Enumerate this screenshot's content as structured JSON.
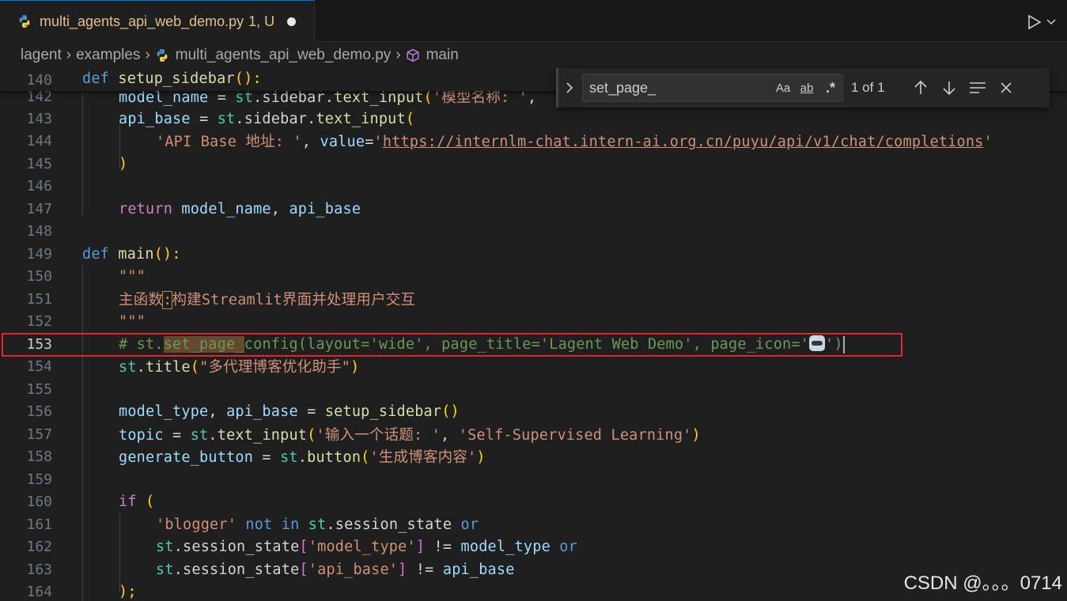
{
  "tab": {
    "filename": "multi_agents_api_web_demo.py",
    "status": "1, U"
  },
  "breadcrumb": {
    "items": [
      "lagent",
      "examples",
      "multi_agents_api_web_demo.py",
      "main"
    ]
  },
  "find": {
    "query": "set_page_",
    "case_label": "Aa",
    "word_label": "ab",
    "regex_label": ".*",
    "count": "1 of 1"
  },
  "lines": {
    "140": "140",
    "142": "142",
    "143": "143",
    "144": "144",
    "145": "145",
    "146": "146",
    "147": "147",
    "148": "148",
    "149": "149",
    "150": "150",
    "151": "151",
    "152": "152",
    "153": "153",
    "154": "154",
    "155": "155",
    "156": "156",
    "157": "157",
    "158": "158",
    "159": "159",
    "160": "160",
    "161": "161",
    "162": "162",
    "163": "163",
    "164": "164"
  },
  "code": {
    "t140": {
      "def": "def",
      "name": "setup_sidebar",
      "rest": "():"
    },
    "t142": {
      "a": "model_name",
      "b": " = ",
      "c": "st",
      "d": ".sidebar.",
      "e": "text_input",
      "f": "(",
      "g": "'模型名称: '",
      "h": ","
    },
    "t143": {
      "a": "api_base",
      "b": " = ",
      "c": "st",
      "d": ".sidebar.",
      "e": "text_input",
      "f": "("
    },
    "t144": {
      "a": "'API Base 地址: '",
      "b": ", ",
      "c": "value",
      "d": "=",
      "e": "'",
      "f": "https://internlm-chat.intern-ai.org.cn/puyu/api/v1/chat/completions",
      "g": "'"
    },
    "t145": {
      "a": ")"
    },
    "t147": {
      "a": "return",
      "b": "model_name",
      "c": ", ",
      "d": "api_base"
    },
    "t149": {
      "def": "def",
      "name": "main",
      "rest": "():"
    },
    "t150": {
      "a": "\"\"\""
    },
    "t151": {
      "a": "主函数",
      "b": ":",
      "c": "构建Streamlit界面并处理用户交互"
    },
    "t152": {
      "a": "\"\"\""
    },
    "t153": {
      "a": "# st.",
      "b": "set_page_",
      "c": "config(layout='wide', page_title='Lagent Web Demo', page_icon='",
      "d": "')"
    },
    "t154": {
      "a": "st",
      "b": ".",
      "c": "title",
      "d": "(",
      "e": "\"多代理博客优化助手\"",
      "f": ")"
    },
    "t156": {
      "a": "model_type",
      "b": ", ",
      "c": "api_base",
      "d": " = ",
      "e": "setup_sidebar",
      "f": "()"
    },
    "t157": {
      "a": "topic",
      "b": " = ",
      "c": "st",
      "d": ".",
      "e": "text_input",
      "f": "(",
      "g": "'输入一个话题: '",
      "h": ", ",
      "i": "'Self-Supervised Learning'",
      "j": ")"
    },
    "t158": {
      "a": "generate_button",
      "b": " = ",
      "c": "st",
      "d": ".",
      "e": "button",
      "f": "(",
      "g": "'生成博客内容'",
      "h": ")"
    },
    "t160": {
      "a": "if",
      "b": " ("
    },
    "t161": {
      "a": "'blogger'",
      "b": " not in ",
      "c": "st",
      "d": ".session_state",
      "e": " or"
    },
    "t162": {
      "a": "st",
      "b": ".session_state",
      "c": "[",
      "d": "'model_type'",
      "e": "]",
      "f": " != ",
      "g": "model_type",
      "h": " or"
    },
    "t163": {
      "a": "st",
      "b": ".session_state",
      "c": "[",
      "d": "'api_base'",
      "e": "]",
      "f": " != ",
      "g": "api_base"
    },
    "t164": {
      "a": ");"
    }
  },
  "watermark": "CSDN @。。。0714"
}
